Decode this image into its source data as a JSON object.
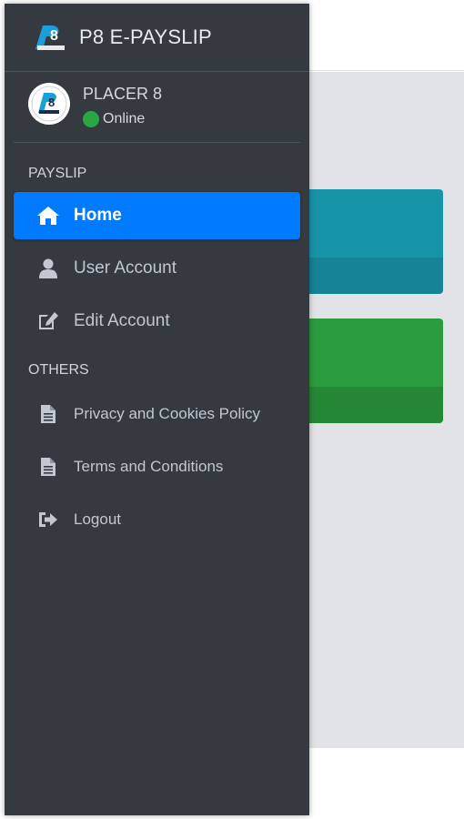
{
  "brand": {
    "title": "P8 E-PAYSLIP"
  },
  "user": {
    "name": "PLACER 8",
    "status": "Online"
  },
  "sections": [
    {
      "header": "PAYSLIP",
      "items": [
        {
          "label": "Home",
          "icon": "home-icon",
          "active": true
        },
        {
          "label": "User Account",
          "icon": "user-icon",
          "active": false
        },
        {
          "label": "Edit Account",
          "icon": "edit-icon",
          "active": false
        }
      ]
    },
    {
      "header": "OTHERS",
      "items": [
        {
          "label": "Privacy and Cookies Policy",
          "icon": "file-icon"
        },
        {
          "label": "Terms and Conditions",
          "icon": "file-icon"
        },
        {
          "label": "Logout",
          "icon": "sign-out-icon"
        }
      ]
    }
  ],
  "colors": {
    "sidebar": "#343a40",
    "active": "#007bff",
    "online": "#28a745",
    "teal_box": "#1794a8",
    "green_box": "#2a9c3d"
  }
}
